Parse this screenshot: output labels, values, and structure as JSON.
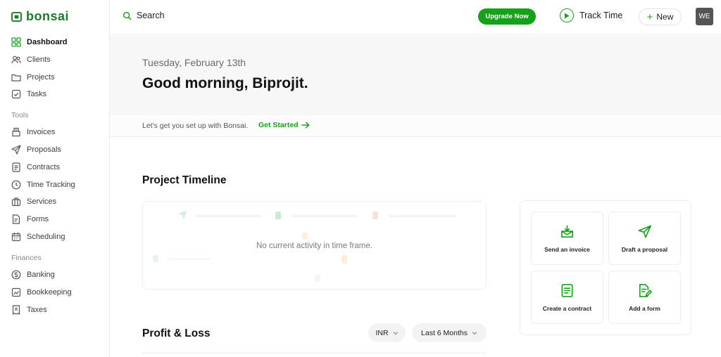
{
  "brand": {
    "name": "bonsai",
    "color": "#1b7a2c",
    "accent": "#17a11b"
  },
  "sidebar": {
    "items": [
      {
        "label": "Dashboard",
        "icon": "grid-icon",
        "active": true
      },
      {
        "label": "Clients",
        "icon": "users-icon"
      },
      {
        "label": "Projects",
        "icon": "folder-icon"
      },
      {
        "label": "Tasks",
        "icon": "checkbox-icon"
      }
    ],
    "tools_heading": "Tools",
    "tools": [
      {
        "label": "Invoices",
        "icon": "invoice-icon"
      },
      {
        "label": "Proposals",
        "icon": "send-icon"
      },
      {
        "label": "Contracts",
        "icon": "document-icon"
      },
      {
        "label": "Time Tracking",
        "icon": "clock-icon"
      },
      {
        "label": "Services",
        "icon": "briefcase-icon"
      },
      {
        "label": "Forms",
        "icon": "form-icon"
      },
      {
        "label": "Scheduling",
        "icon": "calendar-icon"
      }
    ],
    "finances_heading": "Finances",
    "finances": [
      {
        "label": "Banking",
        "icon": "dollar-icon"
      },
      {
        "label": "Bookkeeping",
        "icon": "chart-icon"
      },
      {
        "label": "Taxes",
        "icon": "receipt-icon"
      }
    ]
  },
  "topbar": {
    "search_label": "Search",
    "upgrade_label": "Upgrade Now",
    "track_time_label": "Track Time",
    "new_label": "New",
    "avatar_initials": "WE"
  },
  "greeting": {
    "date": "Tuesday, February 13th",
    "message": "Good morning, Biprojit."
  },
  "setup": {
    "text": "Let's get you set up with Bonsai.",
    "link": "Get Started"
  },
  "timeline": {
    "title": "Project Timeline",
    "empty": "No current activity in time frame."
  },
  "actions": [
    {
      "label": "Send an invoice",
      "icon": "invoice-download-icon"
    },
    {
      "label": "Draft a proposal",
      "icon": "paper-plane-icon"
    },
    {
      "label": "Create a contract",
      "icon": "contract-icon"
    },
    {
      "label": "Add a form",
      "icon": "form-edit-icon"
    }
  ],
  "profit_loss": {
    "title": "Profit & Loss",
    "currency": "INR",
    "period": "Last 6 Months"
  }
}
